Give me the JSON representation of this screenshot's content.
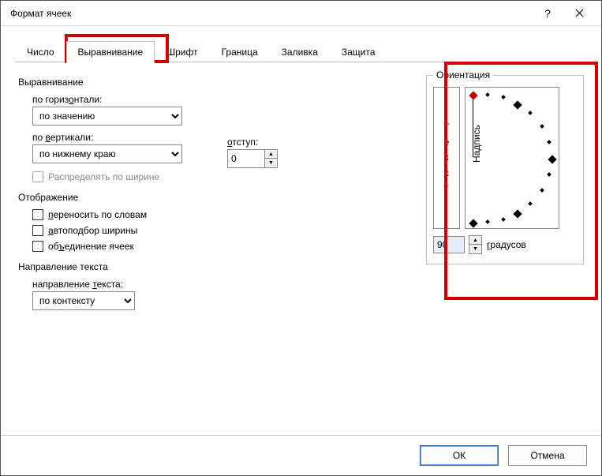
{
  "window": {
    "title": "Формат ячеек"
  },
  "tabs": {
    "items": [
      {
        "label": "Число"
      },
      {
        "label": "Выравнивание"
      },
      {
        "label": "Шрифт"
      },
      {
        "label": "Граница"
      },
      {
        "label": "Заливка"
      },
      {
        "label": "Защита"
      }
    ],
    "active_index": 1
  },
  "alignment": {
    "section_label": "Выравнивание",
    "horizontal": {
      "label_pre": "по гориз",
      "label_u": "о",
      "label_post": "нтали:",
      "value": "по значению"
    },
    "vertical": {
      "label_pre": "по ",
      "label_u": "в",
      "label_post": "ертикали:",
      "value": "по нижнему краю"
    },
    "indent": {
      "label_pre": "",
      "label_u": "о",
      "label_post": "тступ:",
      "value": "0"
    },
    "distribute": {
      "label": "Распределять по ширине"
    }
  },
  "display": {
    "section_label": "Отображение",
    "wrap": {
      "label_u": "п",
      "label_post": "ереносить по словам"
    },
    "shrink": {
      "label_u": "а",
      "label_post": "втоподбор ширины"
    },
    "merge": {
      "label_pre": "об",
      "label_u": "ъ",
      "label_post": "единение ячеек"
    }
  },
  "direction": {
    "section_label": "Направление текста",
    "label_pre": "направление ",
    "label_u": "т",
    "label_post": "екста:",
    "value": "по контексту"
  },
  "orientation": {
    "section_label": "Ориентация",
    "vertical_text": {
      "c1": "Т",
      "c2": "е",
      "c3": "к",
      "c4": "с",
      "c5": "т"
    },
    "needle_label": "Надпись",
    "degrees_value": "90",
    "degrees_label_u": "г",
    "degrees_label_post": "радусов"
  },
  "footer": {
    "ok": "ОК",
    "cancel": "Отмена"
  }
}
